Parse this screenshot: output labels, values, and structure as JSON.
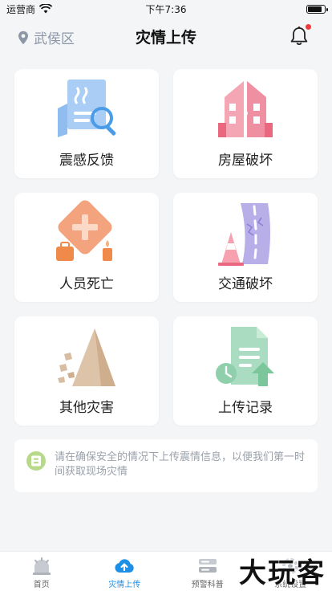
{
  "status_bar": {
    "carrier": "运营商",
    "time": "下午7:36",
    "battery_level": 0.9
  },
  "header": {
    "location": "武侯区",
    "title": "灾情上传",
    "has_notification": true
  },
  "cards": [
    {
      "label": "震感反馈",
      "icon": "seismic-report-icon"
    },
    {
      "label": "房屋破坏",
      "icon": "house-damage-icon"
    },
    {
      "label": "人员死亡",
      "icon": "casualty-icon"
    },
    {
      "label": "交通破坏",
      "icon": "road-damage-icon"
    },
    {
      "label": "其他灾害",
      "icon": "landslide-icon"
    },
    {
      "label": "上传记录",
      "icon": "upload-record-icon"
    }
  ],
  "tip": {
    "text": "请在确保安全的情况下上传震情信息，以便我们第一时间获取现场灾情",
    "icon": "info-icon"
  },
  "tabbar": [
    {
      "label": "首页",
      "icon": "home-icon",
      "active": false
    },
    {
      "label": "灾情上传",
      "icon": "upload-cloud-icon",
      "active": true
    },
    {
      "label": "预警科普",
      "icon": "book-icon",
      "active": false
    },
    {
      "label": "系统设置",
      "icon": "settings-icon",
      "active": false
    }
  ],
  "watermark": "大玩客",
  "colors": {
    "accent": "#1d8fe6",
    "notification_dot": "#ef3b3b",
    "muted": "#8c96a5"
  }
}
